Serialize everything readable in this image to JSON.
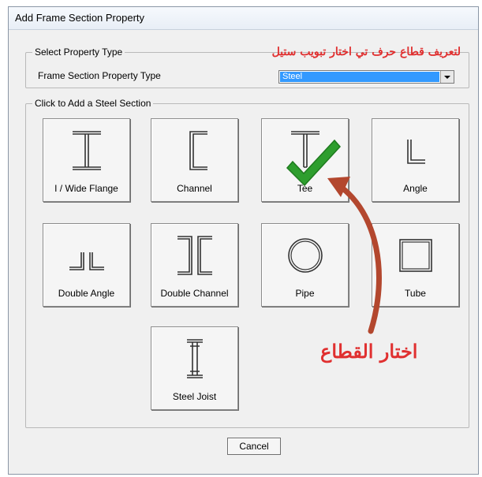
{
  "window": {
    "title": "Add Frame Section Property"
  },
  "select_group": {
    "legend": "Select Property Type",
    "field_label": "Frame Section Property Type",
    "selected_type": "Steel"
  },
  "add_group": {
    "legend": "Click to Add a Steel Section"
  },
  "sections": [
    {
      "label": "I / Wide Flange",
      "icon": "i-wide-flange-icon"
    },
    {
      "label": "Channel",
      "icon": "channel-icon"
    },
    {
      "label": "Tee",
      "icon": "tee-icon"
    },
    {
      "label": "Angle",
      "icon": "angle-icon"
    },
    {
      "label": "Double Angle",
      "icon": "double-angle-icon"
    },
    {
      "label": "Double Channel",
      "icon": "double-channel-icon"
    },
    {
      "label": "Pipe",
      "icon": "pipe-icon"
    },
    {
      "label": "Tube",
      "icon": "tube-icon"
    },
    {
      "label": "Steel Joist",
      "icon": "steel-joist-icon"
    }
  ],
  "cancel_label": "Cancel",
  "annotations": {
    "top_note": "لتعريف قطاع حرف تي اختار تبويب ستيل",
    "choose_section": "اختار القطاع",
    "note_color": "#e03030",
    "arrow_color": "#b3472e",
    "check_color": "#2e9e2e"
  }
}
